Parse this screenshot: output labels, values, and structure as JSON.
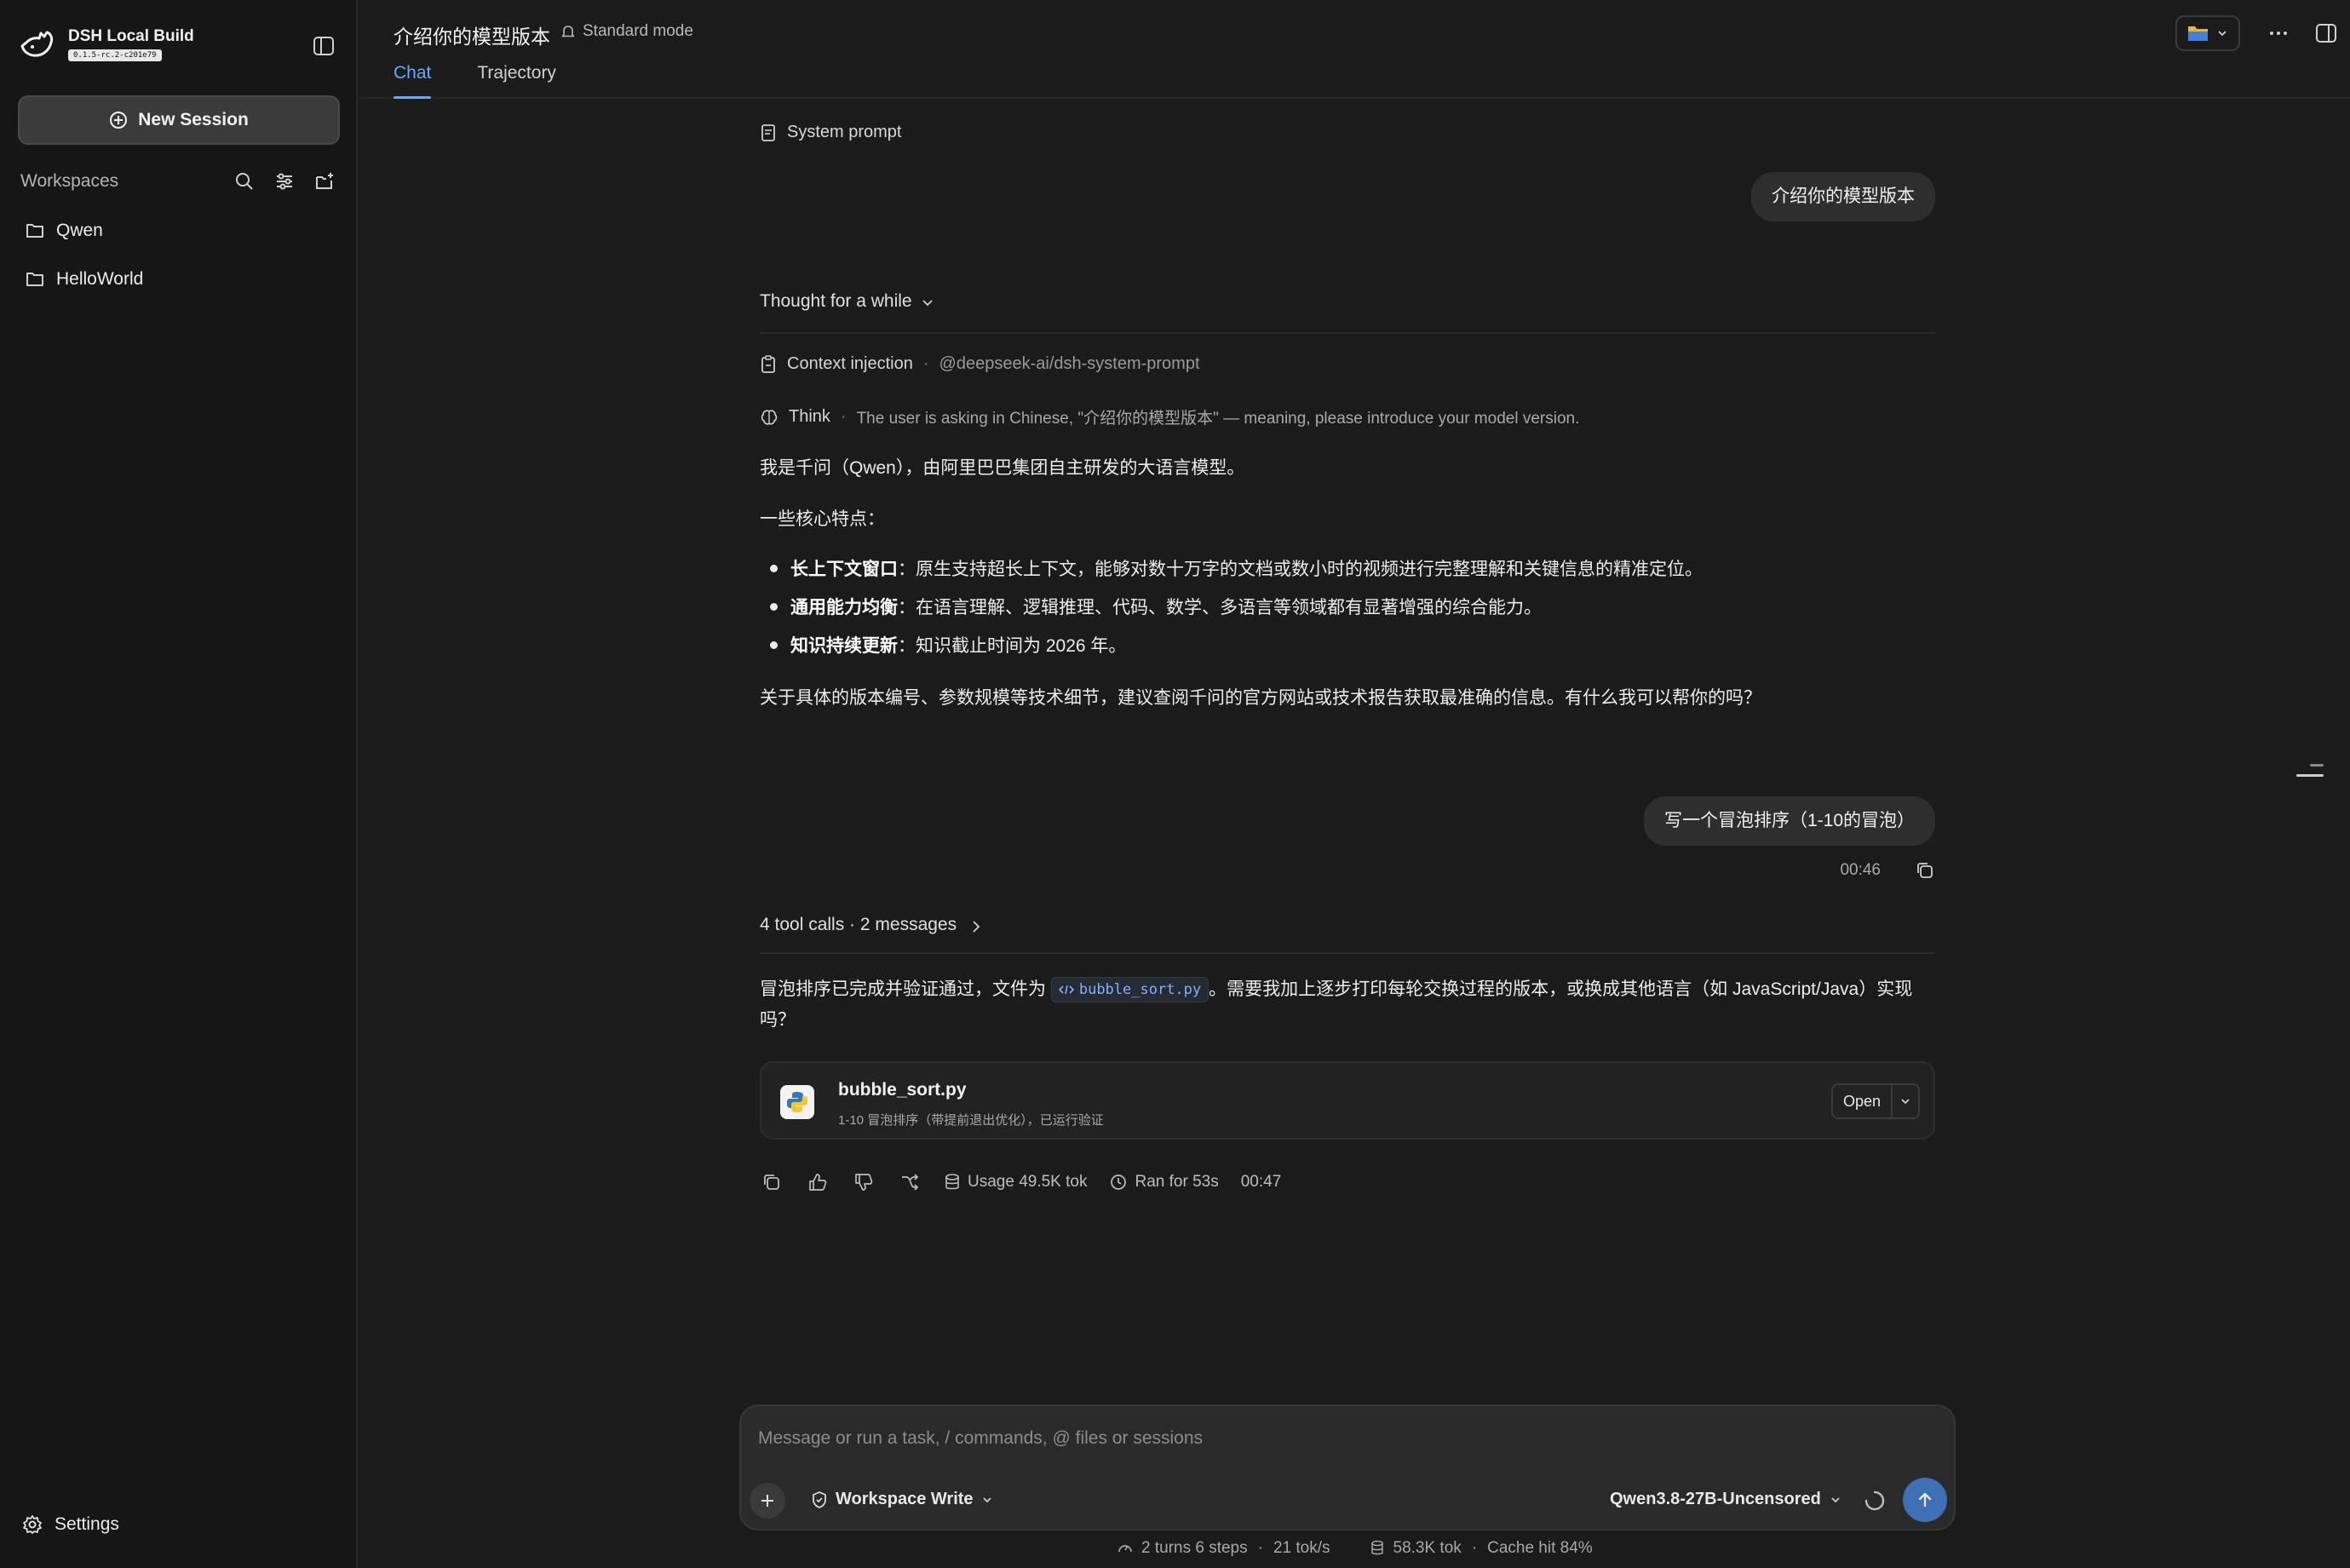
{
  "brand": {
    "name": "DSH Local Build",
    "version": "0.1.5-rc.2-c201e79"
  },
  "sidebar": {
    "new_session": "New Session",
    "workspaces_title": "Workspaces",
    "workspaces": [
      {
        "label": "Qwen"
      },
      {
        "label": "HelloWorld"
      }
    ],
    "settings": "Settings"
  },
  "header": {
    "title": "介绍你的模型版本",
    "mode": "Standard mode",
    "tabs": [
      {
        "label": "Chat",
        "active": true
      },
      {
        "label": "Trajectory",
        "active": false
      }
    ]
  },
  "chat": {
    "system_prompt": "System prompt",
    "user_message_1": "介绍你的模型版本",
    "thought": "Thought for a while",
    "context_injection": {
      "label": "Context injection",
      "value": "@deepseek-ai/dsh-system-prompt"
    },
    "think": {
      "label": "Think",
      "value": "The user is asking in Chinese, \"介绍你的模型版本\" — meaning, please introduce your model version."
    },
    "reply_1": {
      "intro": "我是千问（Qwen），由阿里巴巴集团自主研发的大语言模型。",
      "features_title": "一些核心特点：",
      "features": [
        {
          "bold": "长上下文窗口",
          "text": "：原生支持超长上下文，能够对数十万字的文档或数小时的视频进行完整理解和关键信息的精准定位。"
        },
        {
          "bold": "通用能力均衡",
          "text": "：在语言理解、逻辑推理、代码、数学、多语言等领域都有显著增强的综合能力。"
        },
        {
          "bold": "知识持续更新",
          "text": "：知识截止时间为 2026 年。"
        }
      ],
      "closing": "关于具体的版本编号、参数规模等技术细节，建议查阅千问的官方网站或技术报告获取最准确的信息。有什么我可以帮你的吗？"
    },
    "user_message_2": "写一个冒泡排序（1-10的冒泡）",
    "user_message_2_time": "00:46",
    "tool_calls": "4 tool calls · 2 messages",
    "reply_2": {
      "before": "冒泡排序已完成并验证通过，文件为",
      "code": "bubble_sort.py",
      "after": "。需要我加上逐步打印每轮交换过程的版本，或换成其他语言（如 JavaScript/Java）实现吗？"
    },
    "file_card": {
      "name": "bubble_sort.py",
      "desc": "1-10 冒泡排序（带提前退出优化），已运行验证",
      "open": "Open"
    },
    "actions": {
      "usage": "Usage 49.5K tok",
      "ran": "Ran for 53s",
      "time": "00:47"
    }
  },
  "composer": {
    "placeholder": "Message or run a task, / commands, @ files or sessions",
    "permission": "Workspace Write",
    "model": "Qwen3.8-27B-Uncensored"
  },
  "status": {
    "turns": "2 turns 6 steps",
    "speed": "21 tok/s",
    "tokens": "58.3K tok",
    "cache": "Cache hit 84%"
  },
  "colors": {
    "accent": "#6aa8ff",
    "send": "#3f6fb5",
    "background": "#1b1b1b",
    "sidebar": "#161616"
  }
}
